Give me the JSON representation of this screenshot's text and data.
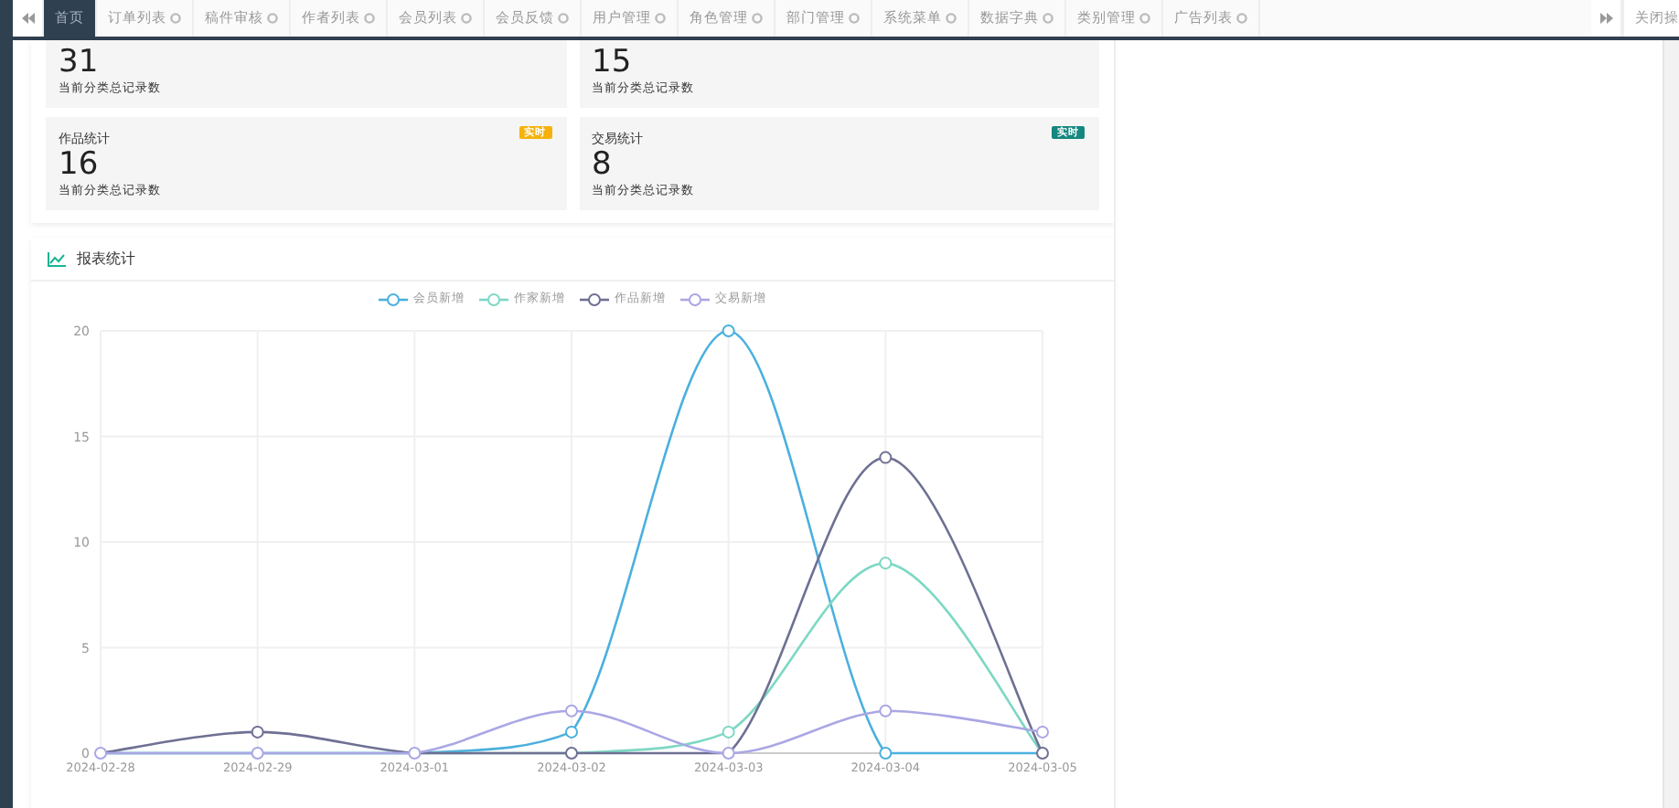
{
  "tabbar": {
    "tabs": [
      {
        "label": "首页",
        "selected": true,
        "closable": false
      },
      {
        "label": "订单列表",
        "selected": false,
        "closable": true
      },
      {
        "label": "稿件审核",
        "selected": false,
        "closable": true
      },
      {
        "label": "作者列表",
        "selected": false,
        "closable": true
      },
      {
        "label": "会员列表",
        "selected": false,
        "closable": true
      },
      {
        "label": "会员反馈",
        "selected": false,
        "closable": true
      },
      {
        "label": "用户管理",
        "selected": false,
        "closable": true
      },
      {
        "label": "角色管理",
        "selected": false,
        "closable": true
      },
      {
        "label": "部门管理",
        "selected": false,
        "closable": true
      },
      {
        "label": "系统菜单",
        "selected": false,
        "closable": true
      },
      {
        "label": "数据字典",
        "selected": false,
        "closable": true
      },
      {
        "label": "类别管理",
        "selected": false,
        "closable": true
      },
      {
        "label": "广告列表",
        "selected": false,
        "closable": true
      }
    ],
    "close_menu": "关闭操"
  },
  "stats": [
    {
      "value": "31",
      "caption": "当前分类总记录数"
    },
    {
      "value": "15",
      "caption": "当前分类总记录数"
    },
    {
      "title": "作品统计",
      "badge": "实时",
      "color": "#f5b20c",
      "value": "16",
      "caption": "当前分类总记录数"
    },
    {
      "title": "交易统计",
      "badge": "实时",
      "color": "#15877f",
      "value": "8",
      "caption": "当前分类总记录数"
    }
  ],
  "report": {
    "title": "报表统计",
    "chart_data": {
      "type": "line",
      "categories": [
        "2024-02-28",
        "2024-02-29",
        "2024-03-01",
        "2024-03-02",
        "2024-03-03",
        "2024-03-04",
        "2024-03-05"
      ],
      "ylim": [
        0,
        20
      ],
      "grid": true,
      "yticks": [
        0,
        5,
        10,
        15,
        20
      ],
      "series": [
        {
          "name": "会员新增",
          "color": "#4bb0de",
          "marker": true,
          "values": [
            0,
            0,
            0,
            1,
            20,
            0,
            0
          ]
        },
        {
          "name": "作家新增",
          "color": "#7dd8c4",
          "marker": true,
          "values": [
            0,
            0,
            0,
            0,
            1,
            9,
            0
          ]
        },
        {
          "name": "作品新增",
          "color": "#6e7093",
          "marker": true,
          "values": [
            0,
            1,
            0,
            0,
            0,
            14,
            0
          ]
        },
        {
          "name": "交易新增",
          "color": "#aaa7e4",
          "marker": true,
          "values": [
            0,
            0,
            0,
            2,
            0,
            2,
            1
          ]
        }
      ]
    }
  }
}
